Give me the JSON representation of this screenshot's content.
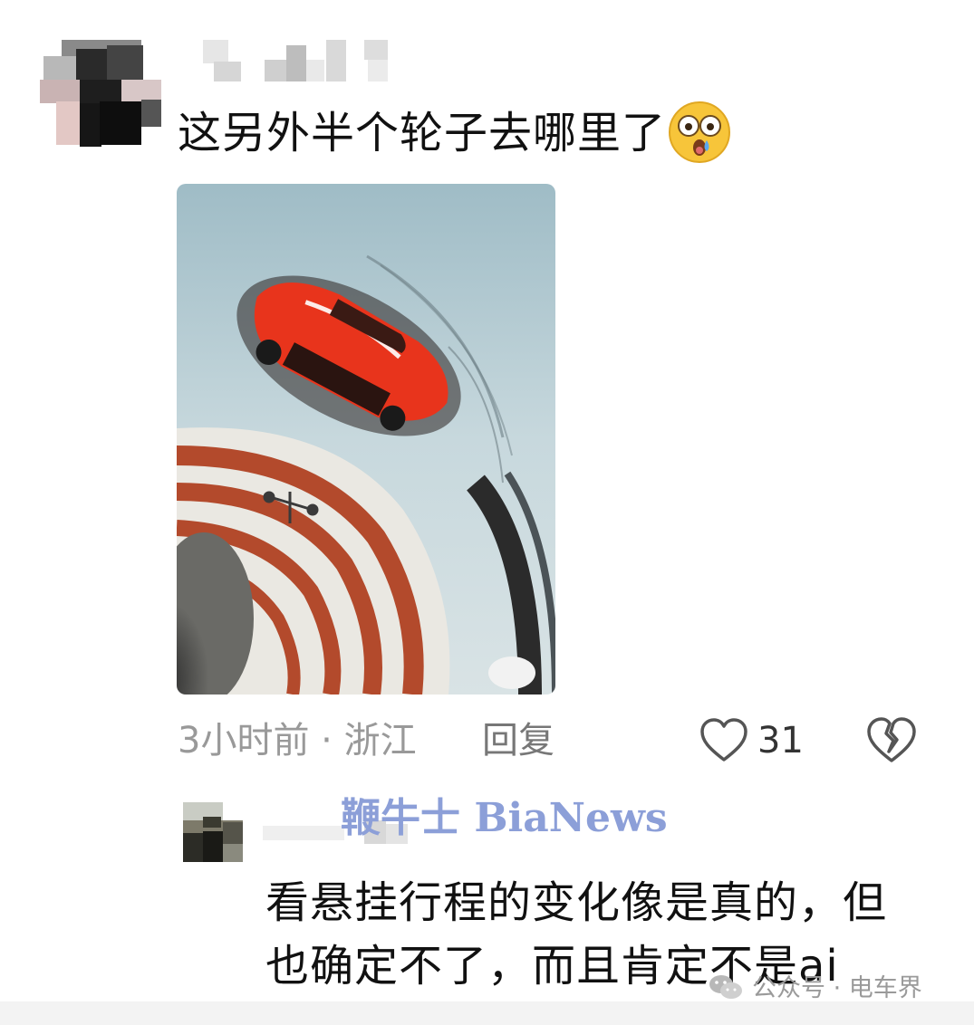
{
  "comment": {
    "text": "这另外半个轮子去哪里了",
    "emoji": "astonished-face",
    "meta": {
      "time_location": "3小时前 · 浙江",
      "reply_label": "回复",
      "like_count": "31"
    }
  },
  "reply": {
    "text": "看悬挂行程的变化像是真的，但也确定不了，而且肯定不是ai"
  },
  "watermark": "鞭牛士 BiaNews",
  "footer": {
    "source": "公众号 · 电车界"
  },
  "colors": {
    "meta_gray": "#999999",
    "watermark_blue": "#8c9fd8",
    "car_red": "#e8341c"
  }
}
